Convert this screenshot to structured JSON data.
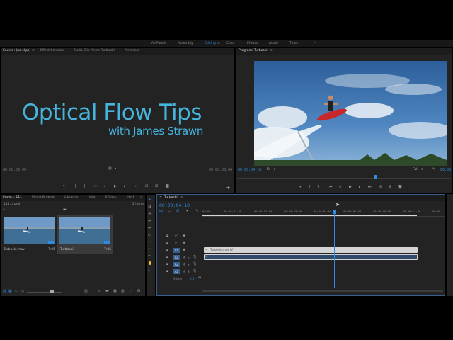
{
  "workspaces": {
    "items": [
      "All Panels",
      "Assembly",
      "Editing",
      "Color",
      "Effects",
      "Audio",
      "Titles"
    ],
    "active": "Editing",
    "menu_icon": "≡",
    "overflow": "»"
  },
  "source_panel": {
    "tabs": [
      "Source: (no clips)",
      "Effect Controls",
      "Audio Clip Mixer: Turboski",
      "Metadata"
    ],
    "menu_icon": "≡",
    "title_line1": "Optical Flow Tips",
    "title_line2": "with James Strawn",
    "timecode_left": "00:00:00:00",
    "timecode_right": "00:00:00:00"
  },
  "program_panel": {
    "tab": "Program: Turboski",
    "menu_icon": "≡",
    "timecode": "00:00:04:10",
    "fit": "Fit",
    "quality": "Full",
    "timecode_right": "00:00"
  },
  "project_panel": {
    "tabs": [
      "Project: 111",
      "Media Browser",
      "Libraries",
      "Info",
      "Effects",
      "Mark"
    ],
    "overflow": "»",
    "file": "111.prproj",
    "items_count": "2 Items",
    "clips": [
      {
        "name": "Turboski.mov",
        "duration": "7:05"
      },
      {
        "name": "Turboski",
        "duration": "7:05"
      }
    ]
  },
  "timeline": {
    "tab": "Turboski",
    "menu_icon": "≡",
    "timecode": "00:00:04:10",
    "ruler": [
      "00:00",
      "00:00:01:00",
      "00:00:02:00",
      "00:00:03:00",
      "00:00:04:00",
      "00:00:05:00",
      "00:00:06:00",
      "00:00:07:00",
      "00:00"
    ],
    "video_tracks": [
      "V3",
      "V2",
      "V1"
    ],
    "audio_tracks": [
      "A1",
      "A2",
      "A3"
    ],
    "master_label": "Master",
    "master_value": "0.0",
    "video_clip_label": "Turboski.mov [V]",
    "playhead_fraction": 0.6
  },
  "colors": {
    "accent": "#2e8ce3",
    "panel": "#232323",
    "title": "#46b5dd"
  }
}
